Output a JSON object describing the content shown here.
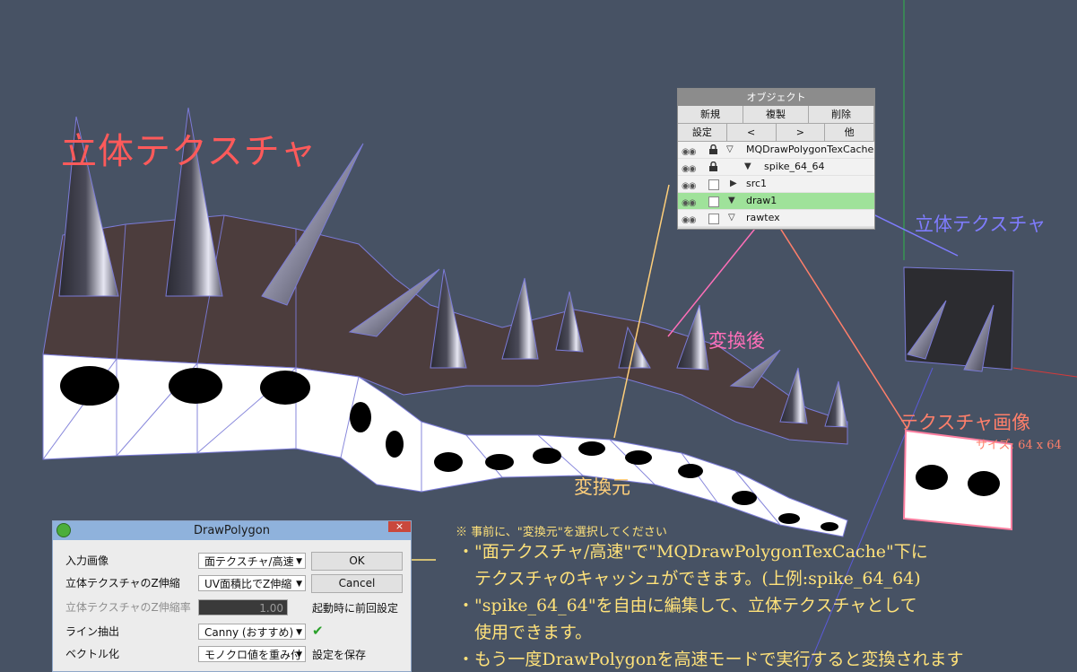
{
  "labels": {
    "main_title": "立体テクスチャ",
    "solid_texture_right": "立体テクスチャ",
    "after": "変換後",
    "before": "変換元",
    "texture_image": "テクスチャ画像",
    "size": "サイズ: 64 x 64"
  },
  "object_panel": {
    "title": "オブジェクト",
    "buttons_row1": [
      "新規",
      "複製",
      "削除"
    ],
    "buttons_row2": [
      "設定",
      "<",
      ">",
      "他"
    ],
    "items": [
      {
        "name": "MQDrawPolygonTexCache",
        "expand": "▽",
        "lock": true,
        "selected": false
      },
      {
        "name": "spike_64_64",
        "expand": "▼",
        "lock": true,
        "selected": false
      },
      {
        "name": "src1",
        "expand": "▶",
        "lock": false,
        "selected": false
      },
      {
        "name": "draw1",
        "expand": "▼",
        "lock": false,
        "selected": true
      },
      {
        "name": "rawtex",
        "expand": "▽",
        "lock": false,
        "selected": false
      }
    ],
    "eye_glyph": "◉◉"
  },
  "dialog": {
    "title": "DrawPolygon",
    "close": "×",
    "rows": [
      {
        "label": "入力画像",
        "value": "面テクスチャ/高速"
      },
      {
        "label": "立体テクスチャのZ伸縮",
        "value": "UV面積比でZ伸縮"
      },
      {
        "label": "立体テクスチャのZ伸縮率",
        "value": "1.00"
      },
      {
        "label": "ライン抽出",
        "value": "Canny (おすすめ)"
      },
      {
        "label": "ベクトル化",
        "value": "モノクロ値を重み付"
      }
    ],
    "ok": "OK",
    "cancel": "Cancel",
    "startup_label": "起動時に前回設定",
    "save_label": "設定を保存",
    "check": "✔"
  },
  "notes": {
    "header": "※ 事前に、\"変換元\"を選択してください",
    "lines": [
      "・\"面テクスチャ/高速\"で\"MQDrawPolygonTexCache\"下に",
      "　テクスチャのキャッシュができます。(上例:spike_64_64)",
      "・\"spike_64_64\"を自由に編集して、立体テクスチャとして",
      "　使用できます。",
      "・もう一度DrawPolygonを高速モードで実行すると変換されます"
    ]
  },
  "colors": {
    "background": "#475264",
    "title_red": "#ff5a5a",
    "blue_line": "#7f7cff",
    "pink_line": "#ff6fb8",
    "orange_line": "#ffcf7a",
    "salmon_line": "#ff7f6a",
    "note_yellow": "#ffe27a",
    "selected_row": "#9fe29a"
  }
}
